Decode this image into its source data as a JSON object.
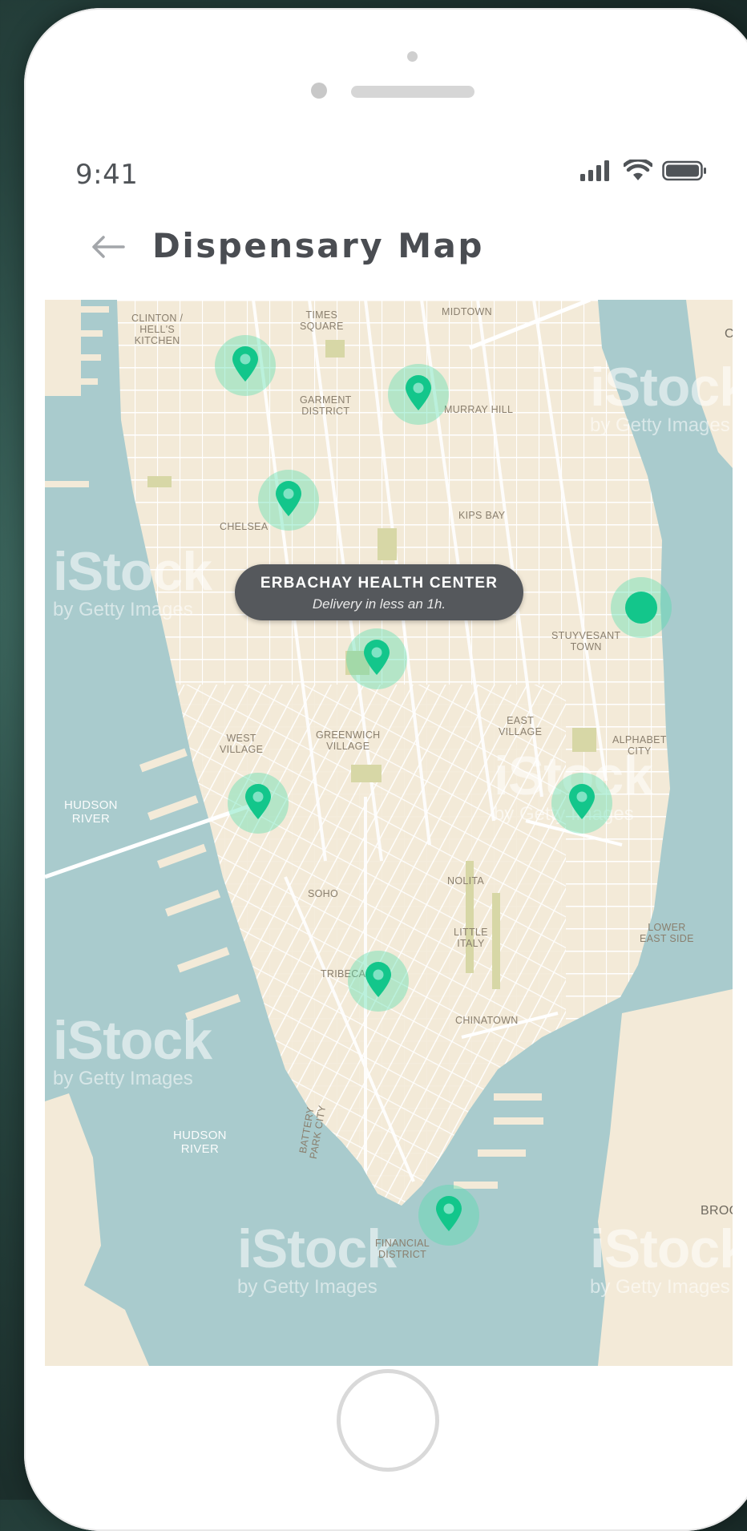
{
  "status_bar": {
    "time": "9:41",
    "icons": [
      "signal-icon",
      "wifi-icon",
      "battery-icon"
    ]
  },
  "header": {
    "back_icon": "arrow-left-icon",
    "title": "Dispensary Map"
  },
  "map": {
    "neighborhoods": [
      "CLINTON /\nHELL'S\nKITCHEN",
      "TIMES\nSQUARE",
      "MIDTOWN",
      "GARMENT\nDISTRICT",
      "MURRAY HILL",
      "KIPS BAY",
      "CHELSEA",
      "STUYVESANT\nTOWN",
      "EAST\nVILLAGE",
      "ALPHABET\nCITY",
      "WEST\nVILLAGE",
      "GREENWICH\nVILLAGE",
      "NOLITA",
      "SOHO",
      "LITTLE\nITALY",
      "LOWER\nEAST SIDE",
      "TRIBECA",
      "CHINATOWN",
      "BATTERY\nPARK CITY",
      "FINANCIAL\nDISTRICT"
    ],
    "water_labels": [
      "HUDSON\nRIVER",
      "HUDSON\nRIVER"
    ],
    "edge_labels": [
      "BROO",
      "C"
    ],
    "watermark": {
      "brand": "iStock",
      "sub": "by Getty Images"
    },
    "tooltip": {
      "title": "ERBACHAY HEALTH CENTER",
      "subtitle": "Delivery in less an 1h."
    },
    "marker_icon": "map-pin-icon",
    "current_location_icon": "current-location-dot",
    "colors": {
      "water": "#a9cbcd",
      "land": "#f3ead8",
      "marker": "#13c68b",
      "marker_halo": "#7fe3c4",
      "tooltip_bg": "#55585c"
    }
  },
  "home_button_icon": "home-button"
}
